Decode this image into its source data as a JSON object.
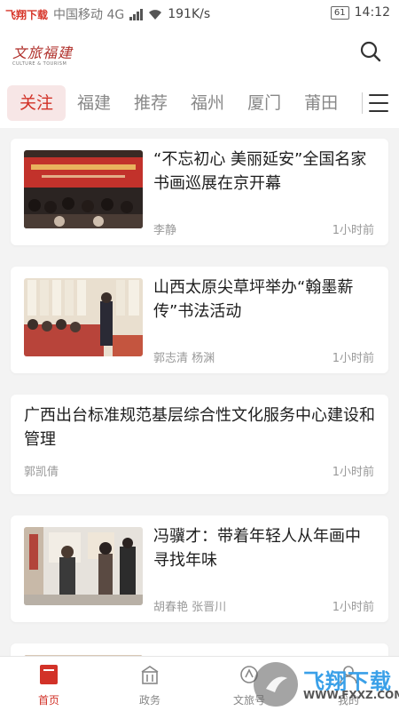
{
  "status_bar": {
    "watermark": "飞翔下载 WWW.FXXZ.COM",
    "carrier": "中国移动 4G",
    "speed": "191K/s",
    "battery": "61",
    "time": "14:12"
  },
  "header": {
    "logo_text": "文旅福建",
    "logo_sub": "CULTURE & TOURISM"
  },
  "tabs": [
    {
      "label": "关注",
      "active": true
    },
    {
      "label": "福建"
    },
    {
      "label": "推荐"
    },
    {
      "label": "福州"
    },
    {
      "label": "厦门"
    },
    {
      "label": "莆田"
    }
  ],
  "articles": [
    {
      "title": "“不忘初心 美丽延安”全国名家书画巡展在京开幕",
      "author": "李静",
      "time": "1小时前",
      "has_image": true
    },
    {
      "title": "山西太原尖草坪举办“翰墨薪传”书法活动",
      "author": "郭志清  杨渊",
      "time": "1小时前",
      "has_image": true
    },
    {
      "title": "广西出台标准规范基层综合性文化服务中心建设和管理",
      "author": "郭凯倩",
      "time": "1小时前",
      "has_image": false
    },
    {
      "title": "冯骥才：带着年轻人从年画中寻找年味",
      "author": "胡春艳  张晋川",
      "time": "1小时前",
      "has_image": true
    }
  ],
  "bottom_nav": [
    {
      "label": "首页",
      "icon": "home-icon",
      "active": true
    },
    {
      "label": "政务",
      "icon": "government-icon"
    },
    {
      "label": "文旅号",
      "icon": "culture-account-icon"
    },
    {
      "label": "我的",
      "icon": "profile-icon"
    }
  ],
  "overlay_watermark": {
    "text": "飞翔下载",
    "url": "WWW.FXXZ.COM"
  },
  "colors": {
    "accent": "#d23228",
    "active_tab_bg": "#f7e6e6",
    "background": "#f3f3f3"
  }
}
